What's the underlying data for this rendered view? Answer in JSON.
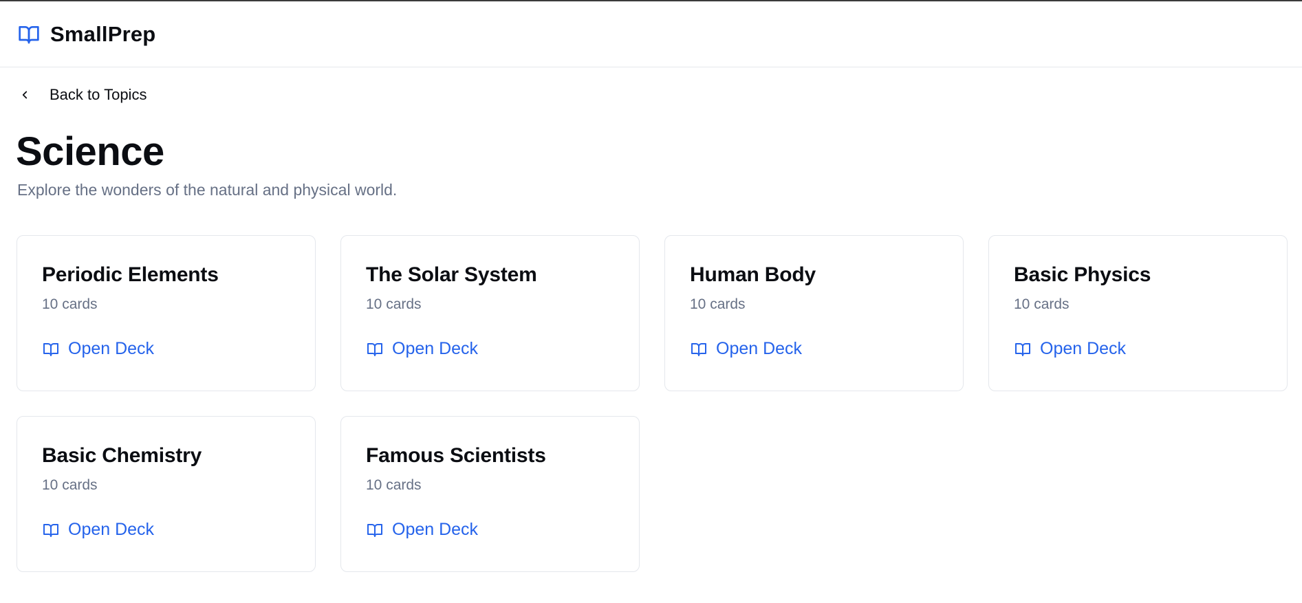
{
  "app": {
    "name": "SmallPrep",
    "icon": "book-open-icon",
    "accent_color": "#2563eb"
  },
  "nav": {
    "back_label": "Back to Topics",
    "back_icon": "chevron-left-icon"
  },
  "page": {
    "title": "Science",
    "subtitle": "Explore the wonders of the natural and physical world."
  },
  "decks": [
    {
      "title": "Periodic Elements",
      "count": "10 cards",
      "action": "Open Deck",
      "id": "periodic-elements"
    },
    {
      "title": "The Solar System",
      "count": "10 cards",
      "action": "Open Deck",
      "id": "solar-system"
    },
    {
      "title": "Human Body",
      "count": "10 cards",
      "action": "Open Deck",
      "id": "human-body"
    },
    {
      "title": "Basic Physics",
      "count": "10 cards",
      "action": "Open Deck",
      "id": "basic-physics"
    },
    {
      "title": "Basic Chemistry",
      "count": "10 cards",
      "action": "Open Deck",
      "id": "basic-chemistry"
    },
    {
      "title": "Famous Scientists",
      "count": "10 cards",
      "action": "Open Deck",
      "id": "famous-scientists"
    }
  ]
}
